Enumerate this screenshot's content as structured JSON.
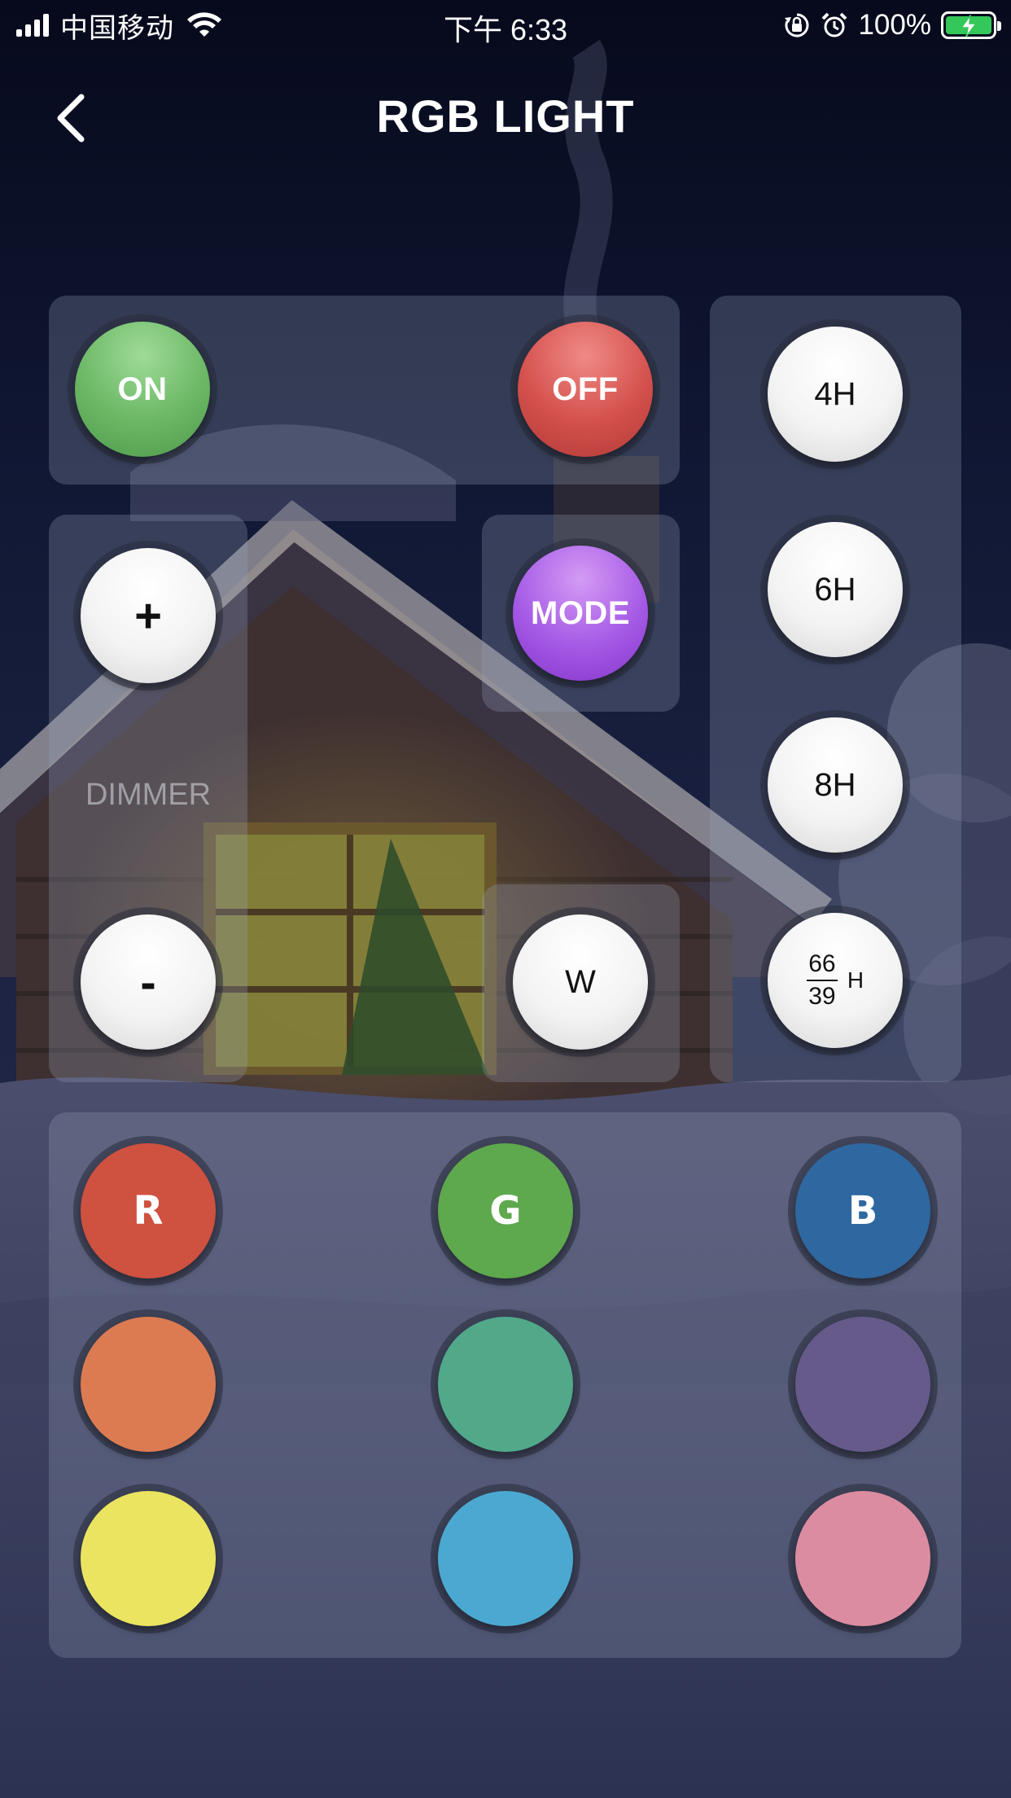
{
  "status_bar": {
    "carrier": "中国移动",
    "time": "下午 6:33",
    "battery_percent": "100%",
    "signal_bars": 4,
    "icons": [
      "signal-icon",
      "wifi-icon",
      "rotation-lock-icon",
      "alarm-icon",
      "battery-charging-icon"
    ]
  },
  "header": {
    "title": "RGB LIGHT",
    "back_icon": "chevron-left-icon"
  },
  "power": {
    "on_label": "ON",
    "off_label": "OFF"
  },
  "timer": {
    "t4": "4H",
    "t6": "6H",
    "t8": "8H",
    "custom_num": "66",
    "custom_den": "39",
    "custom_unit": "H"
  },
  "dimmer": {
    "plus_label": "+",
    "minus_label": "-",
    "label": "DIMMER"
  },
  "mode": {
    "label": "MODE"
  },
  "white": {
    "label": "W"
  },
  "colors": {
    "r_label": "R",
    "g_label": "G",
    "b_label": "B",
    "swatches": [
      {
        "name": "red",
        "hex": "#cf5140"
      },
      {
        "name": "green",
        "hex": "#5ea84d"
      },
      {
        "name": "blue",
        "hex": "#2f67a0"
      },
      {
        "name": "orange",
        "hex": "#dc7b52"
      },
      {
        "name": "teal",
        "hex": "#51a98a"
      },
      {
        "name": "purple",
        "hex": "#665a8a"
      },
      {
        "name": "yellow",
        "hex": "#ebe461"
      },
      {
        "name": "sky-blue",
        "hex": "#4ba9d1"
      },
      {
        "name": "pink",
        "hex": "#dc8ca0"
      }
    ]
  },
  "theme": {
    "on_green": "#6ab764",
    "off_red": "#d4504c",
    "mode_purple": "#a55ae6",
    "panel_tint": "#969fb9",
    "battery_green": "#34c759"
  }
}
